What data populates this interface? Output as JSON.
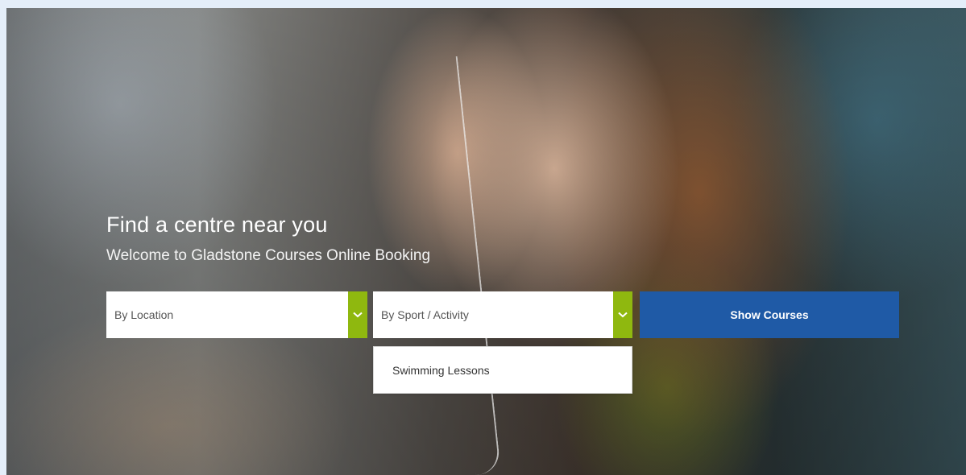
{
  "hero": {
    "title": "Find a centre near you",
    "subtitle": "Welcome to Gladstone Courses Online Booking"
  },
  "search": {
    "location_placeholder": "By Location",
    "sport_placeholder": "By Sport / Activity",
    "show_button_label": "Show Courses",
    "dropdown_icon": "chevron-down-icon"
  },
  "dropdown": {
    "options": [
      "Swimming Lessons"
    ]
  },
  "colors": {
    "accent_green": "#8fb80f",
    "button_blue": "#1f5aa6",
    "text_white": "#ffffff"
  }
}
